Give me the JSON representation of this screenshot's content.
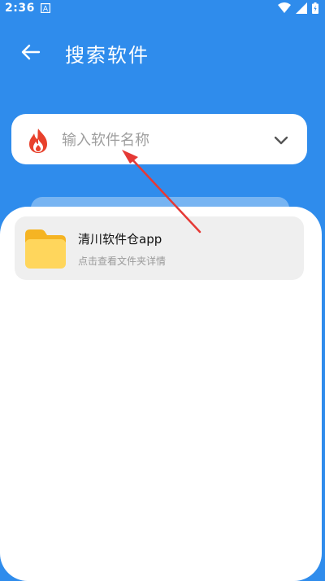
{
  "status_bar": {
    "time": "2:36",
    "icons": [
      "wifi-icon",
      "signal-icon",
      "battery-icon"
    ]
  },
  "header": {
    "title": "搜索软件",
    "back_icon": "arrow-left-icon",
    "background_color": "#2f8cec"
  },
  "search": {
    "placeholder": "输入软件名称",
    "value": "",
    "leading_icon": "fire-icon",
    "trailing_icon": "chevron-down-icon"
  },
  "results": [
    {
      "icon": "folder-icon",
      "title": "清川软件仓app",
      "subtitle": "点击查看文件夹详情"
    }
  ],
  "annotation": {
    "type": "red-arrow",
    "color": "#e53935"
  }
}
